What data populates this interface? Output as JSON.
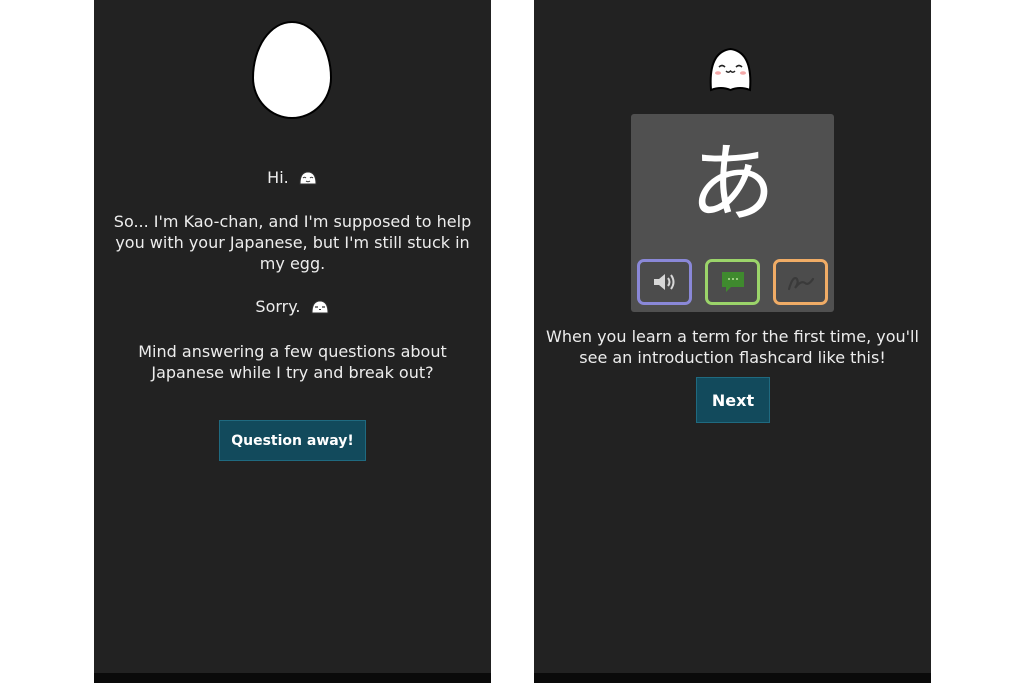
{
  "left_screen": {
    "greeting": "Hi.",
    "intro": "So... I'm Kao-chan, and I'm supposed to help you with your Japanese, but I'm still stuck in my egg.",
    "apology": "Sorry.",
    "question": "Mind answering a few questions about Japanese while I try and break out?",
    "button_label": "Question away!"
  },
  "right_screen": {
    "flashcard": {
      "character": "あ",
      "options": [
        {
          "name": "audio",
          "icon": "speaker-icon",
          "color": "#8a88d8"
        },
        {
          "name": "meaning",
          "icon": "speech-bubble-icon",
          "color": "#9bd46a"
        },
        {
          "name": "writing",
          "icon": "pen-stroke-icon",
          "color": "#f0ac66"
        }
      ]
    },
    "caption": "When you learn a term for the first time, you'll see an introduction flashcard like this!",
    "button_label": "Next"
  },
  "colors": {
    "background": "#222222",
    "text": "#ededed",
    "button": "#124a5c",
    "card": "#505050"
  }
}
